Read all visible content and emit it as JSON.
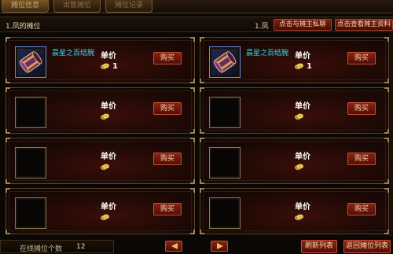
{
  "tabs": [
    {
      "label": "摊位信息",
      "active": true
    },
    {
      "label": "出售摊位",
      "active": false
    },
    {
      "label": "摊位记录",
      "active": false
    }
  ],
  "header": {
    "title": "1.凤的摊位",
    "owner_label": "1.凤",
    "chat_button": "点击与摊主私聊",
    "view_button": "点击查看摊主资料"
  },
  "stall": {
    "unit_price_label": "单价",
    "buy_label": "购买",
    "items": [
      {
        "name": "晨星之百结腕",
        "price": "1",
        "icon": "bracer-icon"
      },
      {
        "name": "晨星之百结腕",
        "price": "1",
        "icon": "bracer-icon"
      },
      {
        "name": "",
        "price": "",
        "icon": ""
      },
      {
        "name": "",
        "price": "",
        "icon": ""
      },
      {
        "name": "",
        "price": "",
        "icon": ""
      },
      {
        "name": "",
        "price": "",
        "icon": ""
      },
      {
        "name": "",
        "price": "",
        "icon": ""
      },
      {
        "name": "",
        "price": "",
        "icon": ""
      }
    ]
  },
  "footer": {
    "online_label": "在线摊位个数",
    "online_count": "12",
    "refresh_button": "刷新列表",
    "back_button": "返回摊位列表"
  },
  "colors": {
    "accent_red": "#8c2212",
    "item_name_cyan": "#38d8f0",
    "gold": "#e6c870"
  }
}
